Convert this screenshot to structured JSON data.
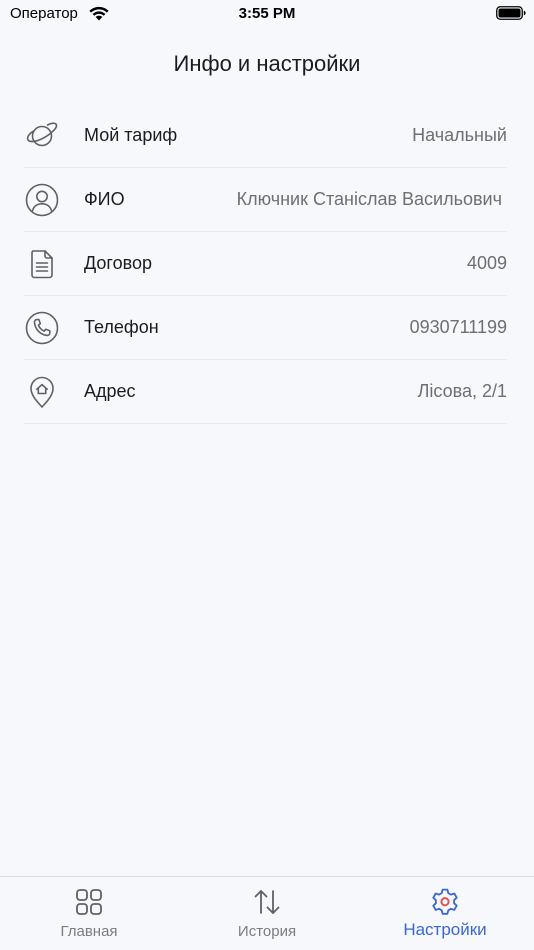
{
  "status_bar": {
    "carrier": "Оператор",
    "time": "3:55 PM"
  },
  "header": {
    "title": "Инфо и настройки"
  },
  "info_rows": [
    {
      "icon": "planet-icon",
      "label": "Мой тариф",
      "value": "Начальный"
    },
    {
      "icon": "user-icon",
      "label": "ФИО",
      "value": "Ключник Станіслав Васильович"
    },
    {
      "icon": "document-icon",
      "label": "Договор",
      "value": "4009"
    },
    {
      "icon": "phone-icon",
      "label": "Телефон",
      "value": "0930711199"
    },
    {
      "icon": "location-home-icon",
      "label": "Адрес",
      "value": "Лісова, 2/1"
    }
  ],
  "tab_bar": {
    "tabs": [
      {
        "icon": "grid-icon",
        "label": "Главная",
        "active": false
      },
      {
        "icon": "arrows-updown-icon",
        "label": "История",
        "active": false
      },
      {
        "icon": "gear-icon",
        "label": "Настройки",
        "active": true
      }
    ]
  },
  "colors": {
    "background": "#f7f8fc",
    "accent": "#3a66d4",
    "accent_dot": "#e5484d",
    "icon_gray": "#5f6165",
    "text_secondary": "#6e6e73"
  }
}
